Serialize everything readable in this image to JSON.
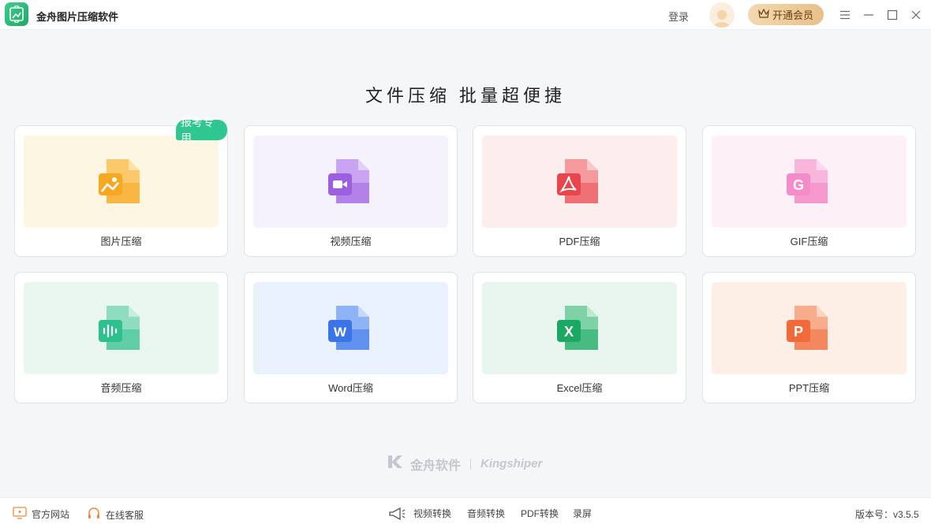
{
  "app": {
    "title": "金舟图片压缩软件"
  },
  "header": {
    "login_label": "登录",
    "vip_label": "开通会员"
  },
  "headline": "文件压缩  批量超便捷",
  "badge": "报考专用",
  "cards": [
    {
      "label": "图片压缩",
      "icon": "image-file-icon"
    },
    {
      "label": "视频压缩",
      "icon": "video-file-icon"
    },
    {
      "label": "PDF压缩",
      "icon": "pdf-file-icon"
    },
    {
      "label": "GIF压缩",
      "icon": "gif-file-icon",
      "glyph": "G"
    },
    {
      "label": "音频压缩",
      "icon": "audio-file-icon"
    },
    {
      "label": "Word压缩",
      "icon": "word-file-icon",
      "glyph": "W"
    },
    {
      "label": "Excel压缩",
      "icon": "excel-file-icon",
      "glyph": "X"
    },
    {
      "label": "PPT压缩",
      "icon": "ppt-file-icon",
      "glyph": "P"
    }
  ],
  "brand": {
    "cn": "金舟软件",
    "en": "Kingshiper"
  },
  "footer": {
    "official_site": "官方网站",
    "online_service": "在线客服",
    "quick_links": [
      "视频转换",
      "音频转换",
      "PDF转换",
      "录屏"
    ],
    "version": "版本号：v3.5.5"
  },
  "colors": {
    "accent_green": "#2fc790",
    "vip_gold": "#e8c089",
    "image": "#f7a823",
    "video": "#9b5fe0",
    "pdf": "#e8454c",
    "gif": "#f07ac0",
    "audio": "#2fc08f",
    "word": "#3a74e8",
    "excel": "#1aa862",
    "ppt": "#f06a3a"
  }
}
